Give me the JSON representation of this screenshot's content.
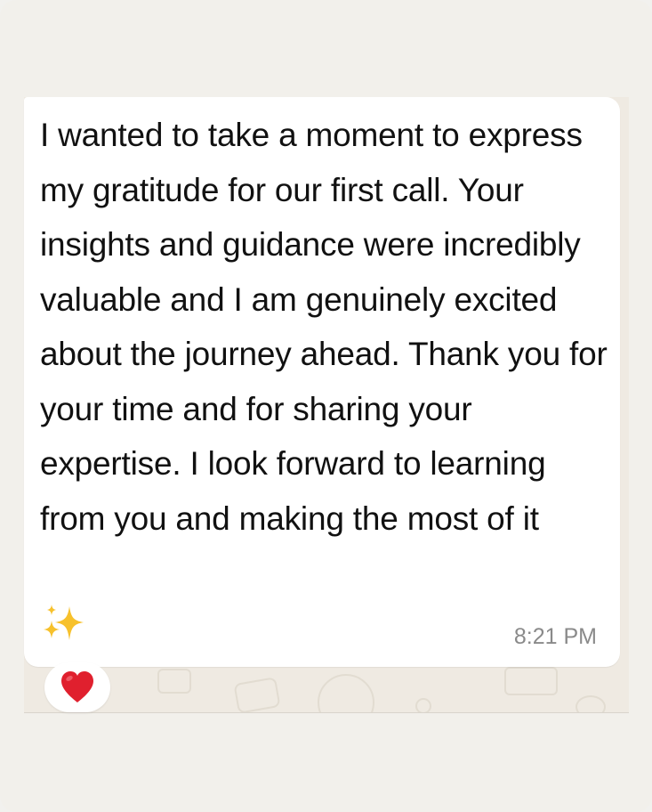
{
  "message": {
    "text": "I wanted to take a moment to express my gratitude for our first call. Your insights and guidance were incredibly valuable and I am genuinely excited about the journey ahead. Thank you for your time and for sharing your expertise. I look forward to learning from you and making the most of it",
    "emoji": "sparkles-emoji",
    "time": "8:21 PM"
  },
  "reaction": {
    "emoji": "red-heart-emoji"
  },
  "colors": {
    "background": "#f2f0eb",
    "chat_wallpaper": "#efeae2",
    "bubble": "#ffffff",
    "timestamp": "#8a8a8a",
    "heart": "#e0202e",
    "sparkles": "#f7c12c"
  }
}
